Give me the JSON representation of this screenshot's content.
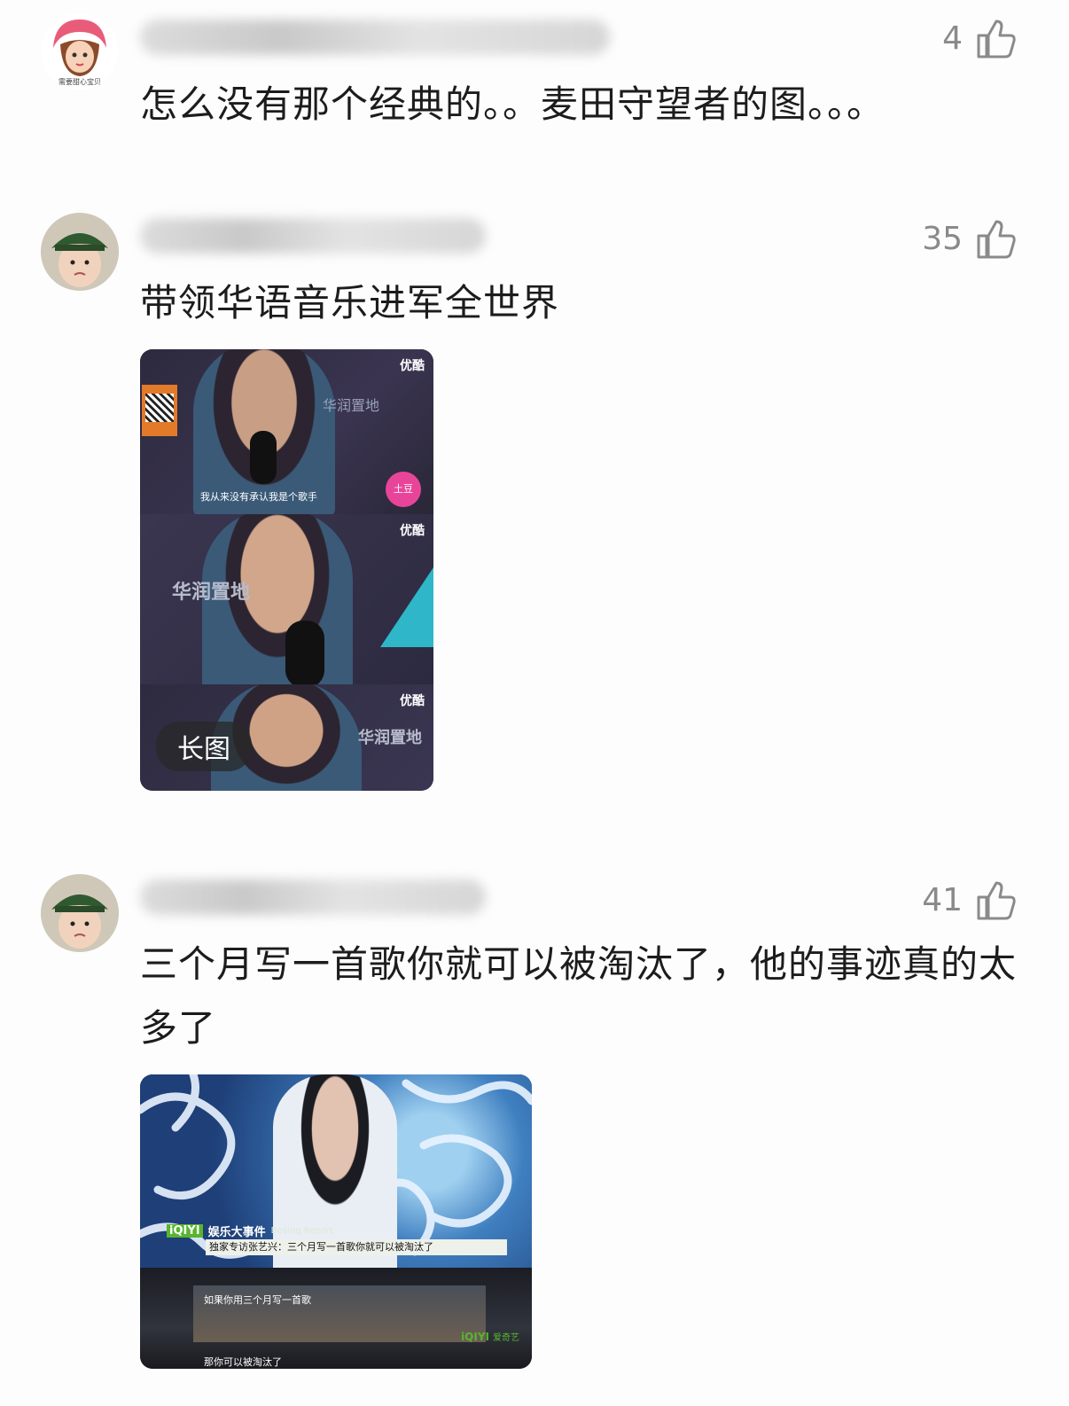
{
  "comments": [
    {
      "likes": "4",
      "text": "怎么没有那个经典的。。麦田守望者的图。。。",
      "avatar_icon": "girl-avatar-icon",
      "avatar_caption": "需要甜心宝贝"
    },
    {
      "likes": "35",
      "text": "带领华语音乐进军全世界",
      "avatar_icon": "boy-green-hat-avatar-icon",
      "image": {
        "tag": "长图",
        "watermark": "优酷",
        "subtitle": "我从来没有承认我是个歌手",
        "sign1": "华润置地",
        "badge": "土豆"
      }
    },
    {
      "likes": "41",
      "text": "三个月写一首歌你就可以被淘汰了，他的事迹真的太多了",
      "avatar_icon": "boy-green-hat-avatar-icon",
      "image": {
        "brand": "iQIYI",
        "show": "娱乐大事件",
        "show_en": "Beijing Report",
        "headline": "独家专访张艺兴：三个月写一首歌你就可以被淘汰了",
        "sub1": "如果你用三个月写一首歌",
        "sub2": "那你可以被淘汰了",
        "watermark": "爱奇艺"
      }
    }
  ],
  "colors": {
    "likes": "#8a8a8a",
    "text": "#1c1c1c",
    "background": "#fdfdfd"
  }
}
